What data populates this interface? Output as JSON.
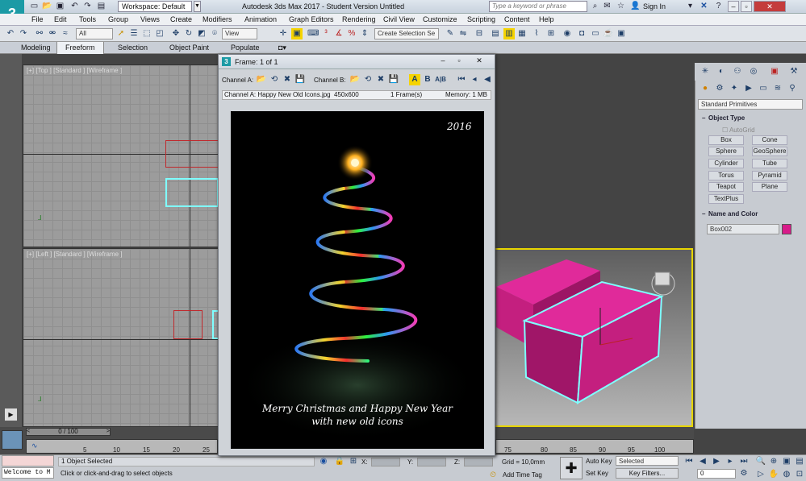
{
  "app": {
    "logo": "3",
    "title": "Autodesk 3ds Max 2017 - Student Version    Untitled",
    "workspace": "Workspace: Default",
    "search_placeholder": "Type a keyword or phrase",
    "signin": "Sign In"
  },
  "menu": [
    "File",
    "Edit",
    "Tools",
    "Group",
    "Views",
    "Create",
    "Modifiers",
    "Animation",
    "Graph Editors",
    "Rendering",
    "Civil View",
    "Customize",
    "Scripting",
    "Content",
    "Help"
  ],
  "toolbar": {
    "filter": "All",
    "view": "View",
    "selection_set": "Create Selection Se"
  },
  "ribbon": {
    "tabs": [
      "Modeling",
      "Freeform",
      "Selection",
      "Object Paint",
      "Populate"
    ],
    "active": "Freeform"
  },
  "viewports": {
    "top": "[+] [Top ] [Standard ] [Wireframe ]",
    "left": "[+] [Left ] [Standard ] [Wireframe ]"
  },
  "frame_window": {
    "title": "Frame: 1 of 1",
    "channel_a_label": "Channel A:",
    "channel_b_label": "Channel B:",
    "btn_a": "A",
    "btn_b": "B",
    "btn_ab": "A|B",
    "info_channel": "Channel A: Happy New Old Icons.jpg",
    "info_size": "450x600",
    "info_frames": "1 Frame(s)",
    "info_memory": "Memory: 1 MB",
    "card_year": "2016",
    "card_line1": "Merry Christmas and Happy New Year",
    "card_line2": "with new old icons"
  },
  "command_panel": {
    "category": "Standard Primitives",
    "object_type_title": "Object Type",
    "autogrid": "AutoGrid",
    "buttons": [
      "Box",
      "Cone",
      "Sphere",
      "GeoSphere",
      "Cylinder",
      "Tube",
      "Torus",
      "Pyramid",
      "Teapot",
      "Plane",
      "TextPlus"
    ],
    "name_color_title": "Name and Color",
    "object_name": "Box002",
    "object_color": "#d81b8a"
  },
  "timeline": {
    "frame_range": "0 / 100",
    "ticks": [
      "5",
      "10",
      "15",
      "20",
      "25",
      "75",
      "80",
      "85",
      "90",
      "95",
      "100"
    ]
  },
  "statusbar": {
    "script_prompt": "Welcome to M",
    "objects_selected": "1 Object Selected",
    "hint": "Click or click-and-drag to select objects",
    "x_label": "X:",
    "y_label": "Y:",
    "z_label": "Z:",
    "grid": "Grid = 10,0mm",
    "add_time_tag": "Add Time Tag",
    "auto_key": "Auto Key",
    "set_key": "Set Key",
    "key_mode": "Selected",
    "key_filters": "Key Filters...",
    "current_frame": "0"
  },
  "colors": {
    "accent": "#1b9aa5",
    "selection_cyan": "#7fffff",
    "box_pink": "#c41f7f",
    "active_viewport_border": "#e7d500"
  }
}
